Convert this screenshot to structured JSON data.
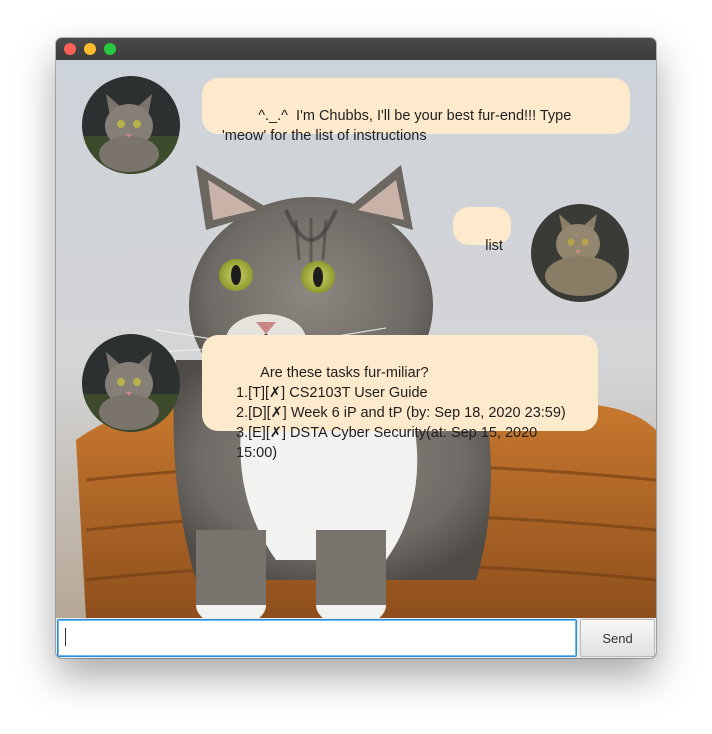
{
  "window": {
    "traffic_lights": {
      "close_color": "#fe5f57",
      "minimize_color": "#febc2e",
      "maximize_color": "#28c840"
    }
  },
  "messages": [
    {
      "sender": "bot",
      "text": "   ^._.^  I'm Chubbs, I'll be your best fur-end!!! Type 'meow' for the list of instructions"
    },
    {
      "sender": "user",
      "text": "list"
    },
    {
      "sender": "bot",
      "text": "Are these tasks fur-miliar?\n1.[T][✗] CS2103T User Guide\n2.[D][✗] Week 6 iP and tP (by: Sep 18, 2020 23:59)\n3.[E][✗] DSTA Cyber Security(at: Sep 15, 2020 15:00)"
    }
  ],
  "input": {
    "value": "",
    "placeholder": ""
  },
  "send_button": {
    "label": "Send"
  },
  "colors": {
    "bubble": "#fde9cb",
    "input_focus_border": "#2a8fd6"
  }
}
